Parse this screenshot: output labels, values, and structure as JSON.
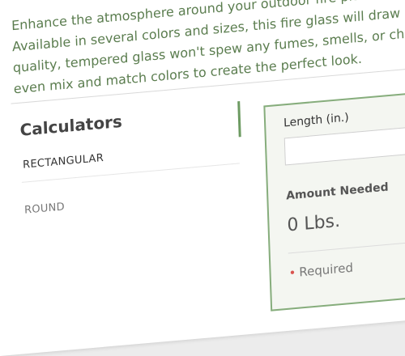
{
  "intro": {
    "lines": [
      "Enhance the atmosphere around your outdoor fire pit",
      "Available in several colors and sizes, this fire glass will draw plenty of",
      "quality, tempered glass won't spew any fumes, smells, or chemicals, a",
      "even mix and match colors to create the perfect look."
    ]
  },
  "calculators": {
    "title": "Calculators",
    "items": [
      "RECTANGULAR",
      "ROUND"
    ]
  },
  "form": {
    "length_label": "Length (in.)",
    "length_value": "",
    "amount_label": "Amount Needed",
    "amount_value": "0 Lbs.",
    "required_star": "•",
    "required_label": "Required"
  },
  "colors": {
    "accent_green": "#86ad7c",
    "intro_text": "#5b7d4f",
    "required_star": "#d9534f"
  }
}
